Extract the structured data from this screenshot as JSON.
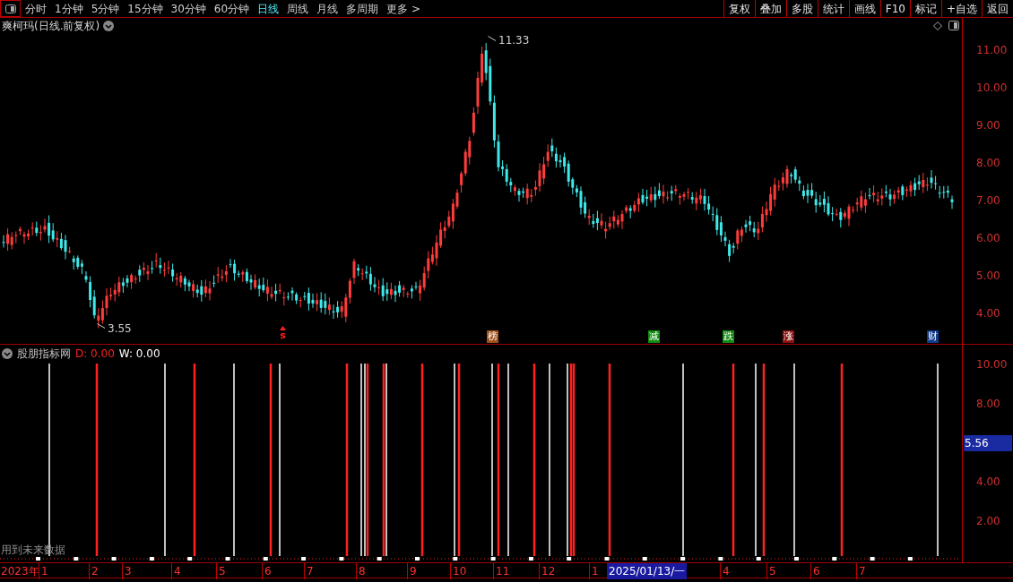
{
  "toolbar": {
    "periods": [
      {
        "label": "分时",
        "selected": false
      },
      {
        "label": "1分钟",
        "selected": false
      },
      {
        "label": "5分钟",
        "selected": false
      },
      {
        "label": "15分钟",
        "selected": false
      },
      {
        "label": "30分钟",
        "selected": false
      },
      {
        "label": "60分钟",
        "selected": false
      },
      {
        "label": "日线",
        "selected": true
      },
      {
        "label": "周线",
        "selected": false
      },
      {
        "label": "月线",
        "selected": false
      },
      {
        "label": "多周期",
        "selected": false
      },
      {
        "label": "更多 >",
        "selected": false
      }
    ],
    "buttons": [
      "复权",
      "叠加",
      "多股",
      "统计",
      "画线",
      "F10",
      "标记",
      "+自选",
      "返回"
    ]
  },
  "price_chart": {
    "title": "爽柯玛(日线.前复权)",
    "high_label": "11.33",
    "low_label": "3.55",
    "y_axis": [
      "11.00",
      "10.00",
      "9.00",
      "8.00",
      "7.00",
      "6.00",
      "5.00",
      "4.00"
    ],
    "events": [
      {
        "label": "s",
        "color": "#ff2020"
      },
      {
        "label": "榜",
        "color": "#a0501a"
      },
      {
        "label": "减",
        "color": "#108a10"
      },
      {
        "label": "跌",
        "color": "#108a10"
      },
      {
        "label": "涨",
        "color": "#8a1010"
      },
      {
        "label": "财",
        "color": "#103a8a"
      }
    ]
  },
  "indicator": {
    "name": "股朋指标网",
    "d_value": "D: 0.00",
    "w_value": "W: 0.00",
    "note": "用到未来数据",
    "y_axis": [
      "10.00",
      "8.00",
      "4.00",
      "2.00"
    ],
    "cursor_value": "5.56"
  },
  "date_axis": {
    "year": "2023年",
    "ticks": [
      {
        "label": "1",
        "kind": "month"
      },
      {
        "label": "2",
        "kind": "month"
      },
      {
        "label": "3",
        "kind": "month"
      },
      {
        "label": "4",
        "kind": "month"
      },
      {
        "label": "5",
        "kind": "month"
      },
      {
        "label": "6",
        "kind": "month"
      },
      {
        "label": "7",
        "kind": "month"
      },
      {
        "label": "8",
        "kind": "month"
      },
      {
        "label": "9",
        "kind": "month"
      },
      {
        "label": "10",
        "kind": "month"
      },
      {
        "label": "11",
        "kind": "month"
      },
      {
        "label": "12",
        "kind": "month"
      },
      {
        "label": "1",
        "kind": "month"
      },
      {
        "label": "2025/01/13/一",
        "kind": "cursor"
      },
      {
        "label": "4",
        "kind": "month"
      },
      {
        "label": "5",
        "kind": "month"
      },
      {
        "label": "6",
        "kind": "month"
      },
      {
        "label": "7",
        "kind": "month"
      }
    ]
  }
}
